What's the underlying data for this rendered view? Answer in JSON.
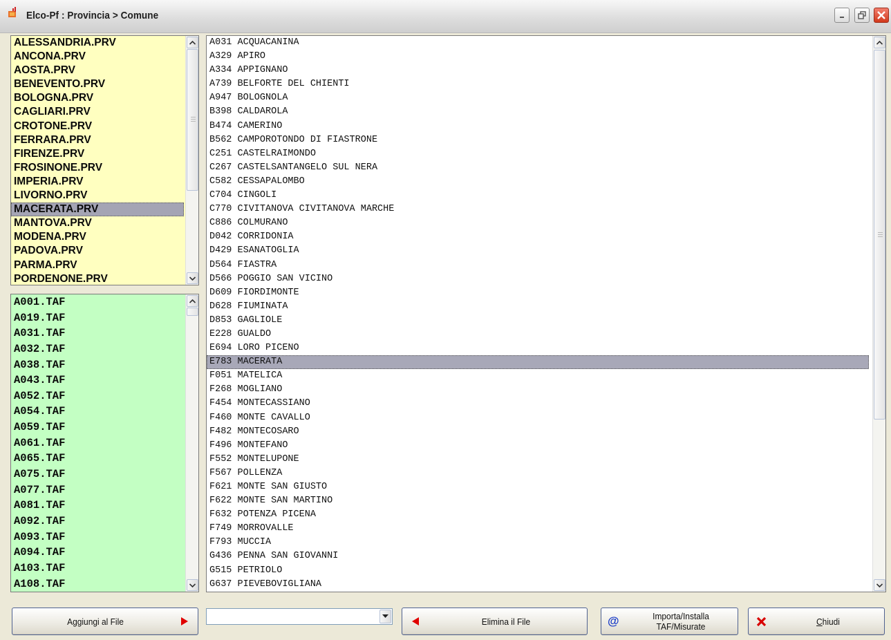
{
  "window": {
    "title": "Elco-Pf : Provincia > Comune"
  },
  "icons": {
    "app": "app-icon",
    "minimize": "minimize-icon",
    "restore": "restore-icon",
    "close": "close-icon"
  },
  "provinces": {
    "items": [
      "ALESSANDRIA.PRV",
      "ANCONA.PRV",
      "AOSTA.PRV",
      "BENEVENTO.PRV",
      "BOLOGNA.PRV",
      "CAGLIARI.PRV",
      "CROTONE.PRV",
      "FERRARA.PRV",
      "FIRENZE.PRV",
      "FROSINONE.PRV",
      "IMPERIA.PRV",
      "LIVORNO.PRV",
      "MACERATA.PRV",
      "MANTOVA.PRV",
      "MODENA.PRV",
      "PADOVA.PRV",
      "PARMA.PRV",
      "PORDENONE.PRV"
    ],
    "selected": "MACERATA.PRV"
  },
  "taf_files": {
    "items": [
      "A001.TAF",
      "A019.TAF",
      "A031.TAF",
      "A032.TAF",
      "A038.TAF",
      "A043.TAF",
      "A052.TAF",
      "A054.TAF",
      "A059.TAF",
      "A061.TAF",
      "A065.TAF",
      "A075.TAF",
      "A077.TAF",
      "A081.TAF",
      "A092.TAF",
      "A093.TAF",
      "A094.TAF",
      "A103.TAF",
      "A108.TAF"
    ]
  },
  "comuni": {
    "items": [
      "A031 ACQUACANINA",
      "A329 APIRO",
      "A334 APPIGNANO",
      "A739 BELFORTE DEL CHIENTI",
      "A947 BOLOGNOLA",
      "B398 CALDAROLA",
      "B474 CAMERINO",
      "B562 CAMPOROTONDO DI FIASTRONE",
      "C251 CASTELRAIMONDO",
      "C267 CASTELSANTANGELO SUL NERA",
      "C582 CESSAPALOMBO",
      "C704 CINGOLI",
      "C770 CIVITANOVA CIVITANOVA MARCHE",
      "C886 COLMURANO",
      "D042 CORRIDONIA",
      "D429 ESANATOGLIA",
      "D564 FIASTRA",
      "D566 POGGIO SAN VICINO",
      "D609 FIORDIMONTE",
      "D628 FIUMINATA",
      "D853 GAGLIOLE",
      "E228 GUALDO",
      "E694 LORO PICENO",
      "E783 MACERATA",
      "F051 MATELICA",
      "F268 MOGLIANO",
      "F454 MONTECASSIANO",
      "F460 MONTE CAVALLO",
      "F482 MONTECOSARO",
      "F496 MONTEFANO",
      "F552 MONTELUPONE",
      "F567 POLLENZA",
      "F621 MONTE SAN GIUSTO",
      "F622 MONTE SAN MARTINO",
      "F632 POTENZA PICENA",
      "F749 MORROVALLE",
      "F793 MUCCIA",
      "G436 PENNA SAN GIOVANNI",
      "G515 PETRIOLO",
      "G637 PIEVEBOVIGLIANA"
    ],
    "selected": "E783 MACERATA"
  },
  "buttons": {
    "add": "Aggiungi al File",
    "delete": "Elimina il File",
    "import_line1": "Importa/Installa",
    "import_line2": "TAF/Misurate",
    "close": "Chiudi",
    "close_mnemonic": "C",
    "close_rest": "hiudi"
  },
  "file_combo": {
    "value": ""
  },
  "colors": {
    "provinces_bg": "#ffffc0",
    "taf_bg": "#c3ffc3",
    "selection": "#a8a8b8",
    "red_arrow": "#e00000"
  }
}
